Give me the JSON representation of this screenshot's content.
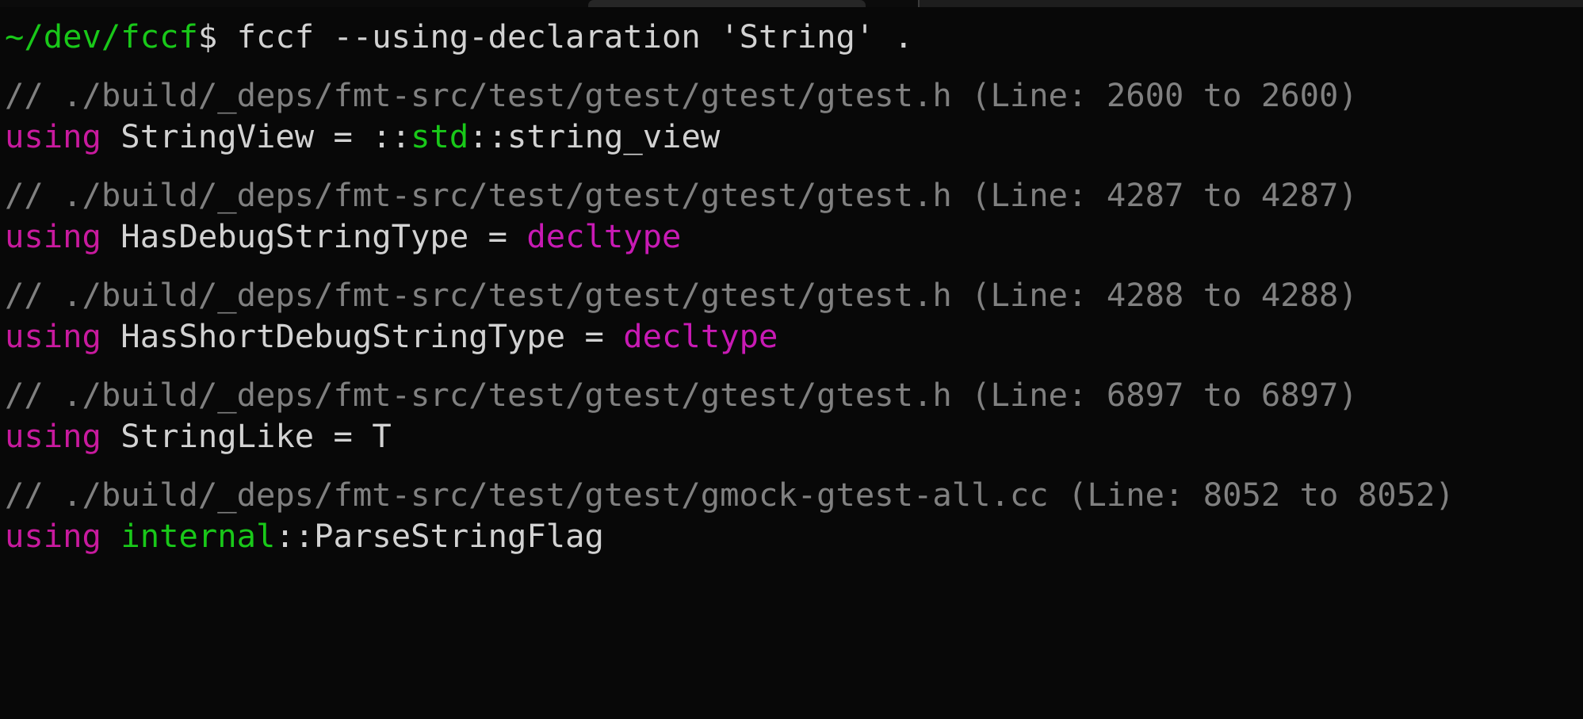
{
  "window": {
    "tab_strip_visible": true,
    "background_color": "#080808",
    "tab_active_color": "#262626"
  },
  "colors": {
    "prompt_green": "#19c819",
    "foreground": "#d2d2d2",
    "comment_gray": "#808080",
    "keyword_magenta": "#c81a9e",
    "type_magenta": "#c81ab4",
    "namespace_green": "#19c819"
  },
  "prompt": {
    "path": "~/dev/fccf",
    "symbol": "$",
    "command": " fccf --using-declaration 'String' ."
  },
  "results": [
    {
      "comment": "// ./build/_deps/fmt-src/test/gtest/gtest/gtest.h (Line: 2600 to 2600)",
      "file": "./build/_deps/fmt-src/test/gtest/gtest/gtest.h",
      "line_start": "2600",
      "line_end": "2600",
      "code": {
        "keyword": "using",
        "identifier": " StringView ",
        "equals": "= ",
        "scope_prefix": "::",
        "namespace": "std",
        "scope_suffix": "::",
        "tail": "string_view",
        "plain": "using StringView = ::std::string_view"
      }
    },
    {
      "comment": "// ./build/_deps/fmt-src/test/gtest/gtest/gtest.h (Line: 4287 to 4287)",
      "file": "./build/_deps/fmt-src/test/gtest/gtest/gtest.h",
      "line_start": "4287",
      "line_end": "4287",
      "code": {
        "keyword": "using",
        "identifier": " HasDebugStringType ",
        "equals": "= ",
        "type": "decltype",
        "plain": "using HasDebugStringType = decltype"
      }
    },
    {
      "comment": "// ./build/_deps/fmt-src/test/gtest/gtest/gtest.h (Line: 4288 to 4288)",
      "file": "./build/_deps/fmt-src/test/gtest/gtest/gtest.h",
      "line_start": "4288",
      "line_end": "4288",
      "code": {
        "keyword": "using",
        "identifier": " HasShortDebugStringType ",
        "equals": "= ",
        "type": "decltype",
        "plain": "using HasShortDebugStringType = decltype"
      }
    },
    {
      "comment": "// ./build/_deps/fmt-src/test/gtest/gtest/gtest.h (Line: 6897 to 6897)",
      "file": "./build/_deps/fmt-src/test/gtest/gtest/gtest.h",
      "line_start": "6897",
      "line_end": "6897",
      "code": {
        "keyword": "using",
        "identifier": " StringLike ",
        "equals": "= ",
        "tail": "T",
        "plain": "using StringLike = T"
      }
    },
    {
      "comment": "// ./build/_deps/fmt-src/test/gtest/gmock-gtest-all.cc (Line: 8052 to 8052)",
      "file": "./build/_deps/fmt-src/test/gtest/gmock-gtest-all.cc",
      "line_start": "8052",
      "line_end": "8052",
      "code": {
        "keyword": "using",
        "namespace": "internal",
        "scope_suffix": "::",
        "tail": "ParseStringFlag",
        "plain": "using internal::ParseStringFlag"
      }
    }
  ]
}
